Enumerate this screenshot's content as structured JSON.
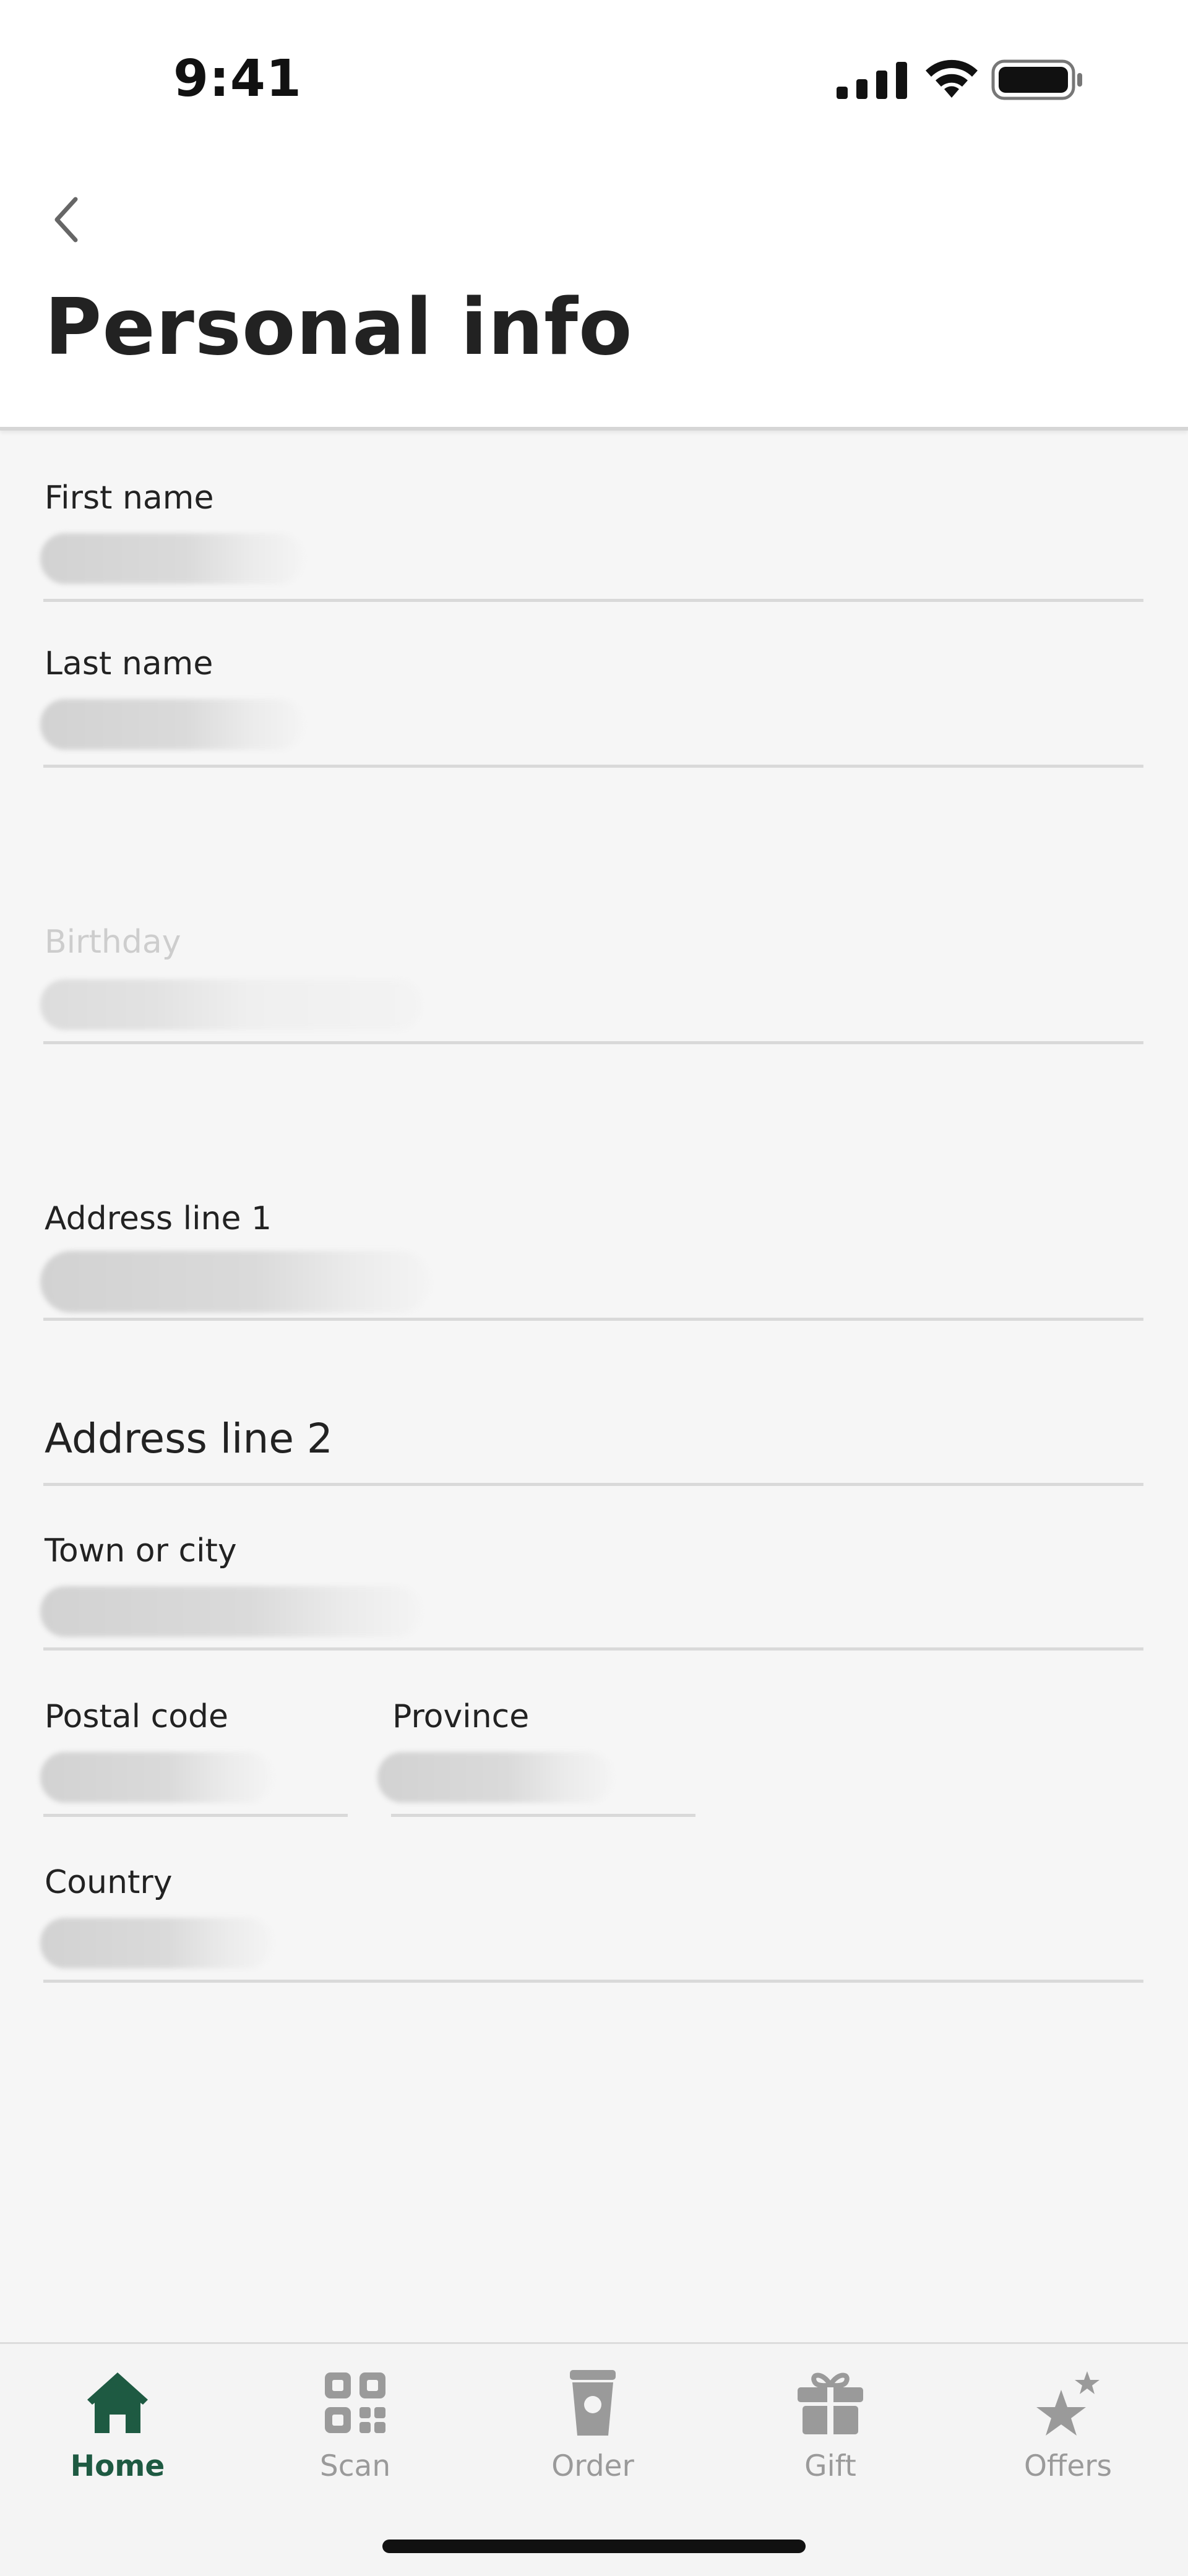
{
  "status_bar": {
    "time": "9:41",
    "icons": [
      "cellular-signal-icon",
      "wifi-icon",
      "battery-icon"
    ]
  },
  "header": {
    "back_icon": "chevron-left-icon",
    "title": "Personal info"
  },
  "form": {
    "first_name": {
      "label": "First name",
      "value": ""
    },
    "last_name": {
      "label": "Last name",
      "value": ""
    },
    "birthday": {
      "label": "Birthday",
      "value": ""
    },
    "address_line_1": {
      "label": "Address line 1",
      "value": ""
    },
    "address_line_2": {
      "label": "Address line 2",
      "value": ""
    },
    "town_or_city": {
      "label": "Town or city",
      "value": ""
    },
    "postal_code": {
      "label": "Postal code",
      "value": ""
    },
    "province": {
      "label": "Province",
      "value": ""
    },
    "country": {
      "label": "Country",
      "value": ""
    }
  },
  "tab_bar": {
    "active_color": "#1e5a42",
    "inactive_color": "#9a9a9a",
    "tabs": [
      {
        "label": "Home",
        "icon": "home-icon",
        "active": true
      },
      {
        "label": "Scan",
        "icon": "qr-code-icon",
        "active": false
      },
      {
        "label": "Order",
        "icon": "coffee-cup-icon",
        "active": false
      },
      {
        "label": "Gift",
        "icon": "gift-icon",
        "active": false
      },
      {
        "label": "Offers",
        "icon": "star-icon",
        "active": false
      }
    ]
  }
}
